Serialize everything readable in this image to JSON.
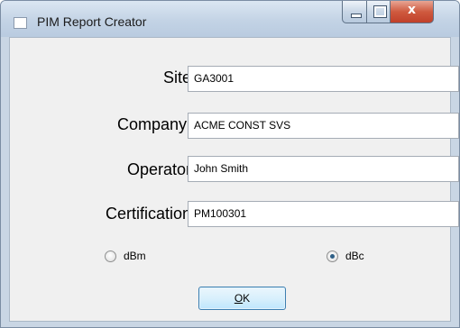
{
  "window": {
    "title": "PIM Report Creator",
    "close_glyph": "x"
  },
  "fields": [
    {
      "label": "Site:",
      "value": "GA3001"
    },
    {
      "label": "Company::",
      "value": "ACME CONST SVS"
    },
    {
      "label": "Operator:",
      "value": "John Smith"
    },
    {
      "label": "Certification:",
      "value": "PM100301"
    }
  ],
  "units": {
    "options": [
      {
        "label": "dBm",
        "selected": false
      },
      {
        "label": "dBc",
        "selected": true
      }
    ]
  },
  "ok_button": {
    "mnemonic": "O",
    "rest": "K"
  },
  "colors": {
    "accent": "#3c7fb1",
    "close_button": "#c0402a"
  }
}
